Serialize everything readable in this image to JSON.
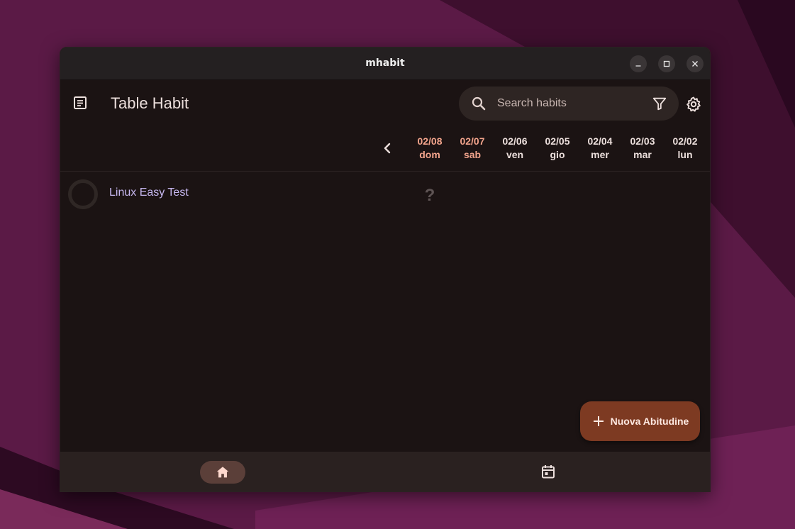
{
  "window": {
    "title": "mhabit",
    "controls": [
      "minimize-icon",
      "maximize-icon",
      "close-icon"
    ]
  },
  "appbar": {
    "title": "Table Habit",
    "menu_icon": "notes-icon",
    "search": {
      "value": "",
      "placeholder": "Search habits"
    },
    "filter_icon": "filter-icon",
    "settings_icon": "gear-icon"
  },
  "dates": [
    {
      "date": "02/08",
      "day": "dom",
      "accent": true
    },
    {
      "date": "02/07",
      "day": "sab",
      "accent": true
    },
    {
      "date": "02/06",
      "day": "ven",
      "accent": false
    },
    {
      "date": "02/05",
      "day": "gio",
      "accent": false
    },
    {
      "date": "02/04",
      "day": "mer",
      "accent": false
    },
    {
      "date": "02/03",
      "day": "mar",
      "accent": false
    },
    {
      "date": "02/02",
      "day": "lun",
      "accent": false
    }
  ],
  "habits": [
    {
      "name": "Linux Easy Test",
      "cell_marks": [
        "?"
      ]
    }
  ],
  "fab": {
    "label": "Nuova Abitudine",
    "icon": "plus-icon"
  },
  "bottom_nav": {
    "items": [
      {
        "icon": "home-icon",
        "selected": true
      },
      {
        "icon": "calendar-icon",
        "selected": false
      }
    ]
  },
  "colors": {
    "accent": "#f2a48c",
    "habit_name": "#c7b8f0",
    "fab_bg": "#7d3a22",
    "window_bg": "#1b1313",
    "nav_selected": "#5b3f39"
  }
}
